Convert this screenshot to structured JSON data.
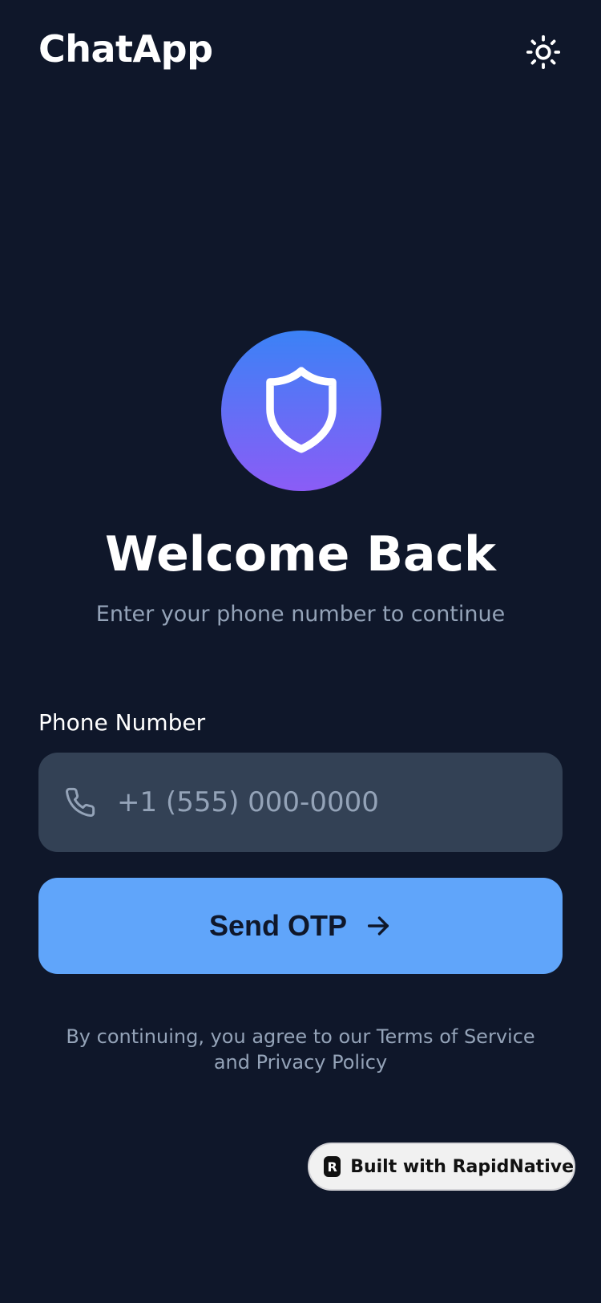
{
  "header": {
    "app_title": "ChatApp",
    "theme_icon": "sun-icon"
  },
  "hero": {
    "icon": "shield-icon",
    "gradient": [
      "#3b82f6",
      "#8b5cf6"
    ],
    "title": "Welcome Back",
    "subtitle": "Enter your phone number to continue"
  },
  "form": {
    "phone_label": "Phone Number",
    "phone_placeholder": "+1 (555) 000-0000",
    "phone_value": "",
    "phone_icon": "phone-icon",
    "submit_label": "Send OTP",
    "submit_icon": "arrow-right-icon"
  },
  "legal": {
    "text": "By continuing, you agree to our Terms of Service and Privacy Policy"
  },
  "badge": {
    "logo_letter": "R",
    "label": "Built with RapidNative"
  },
  "colors": {
    "background": "#0f172a",
    "input_bg": "#334155",
    "accent": "#60a5fa",
    "muted_text": "#94a3b8"
  }
}
